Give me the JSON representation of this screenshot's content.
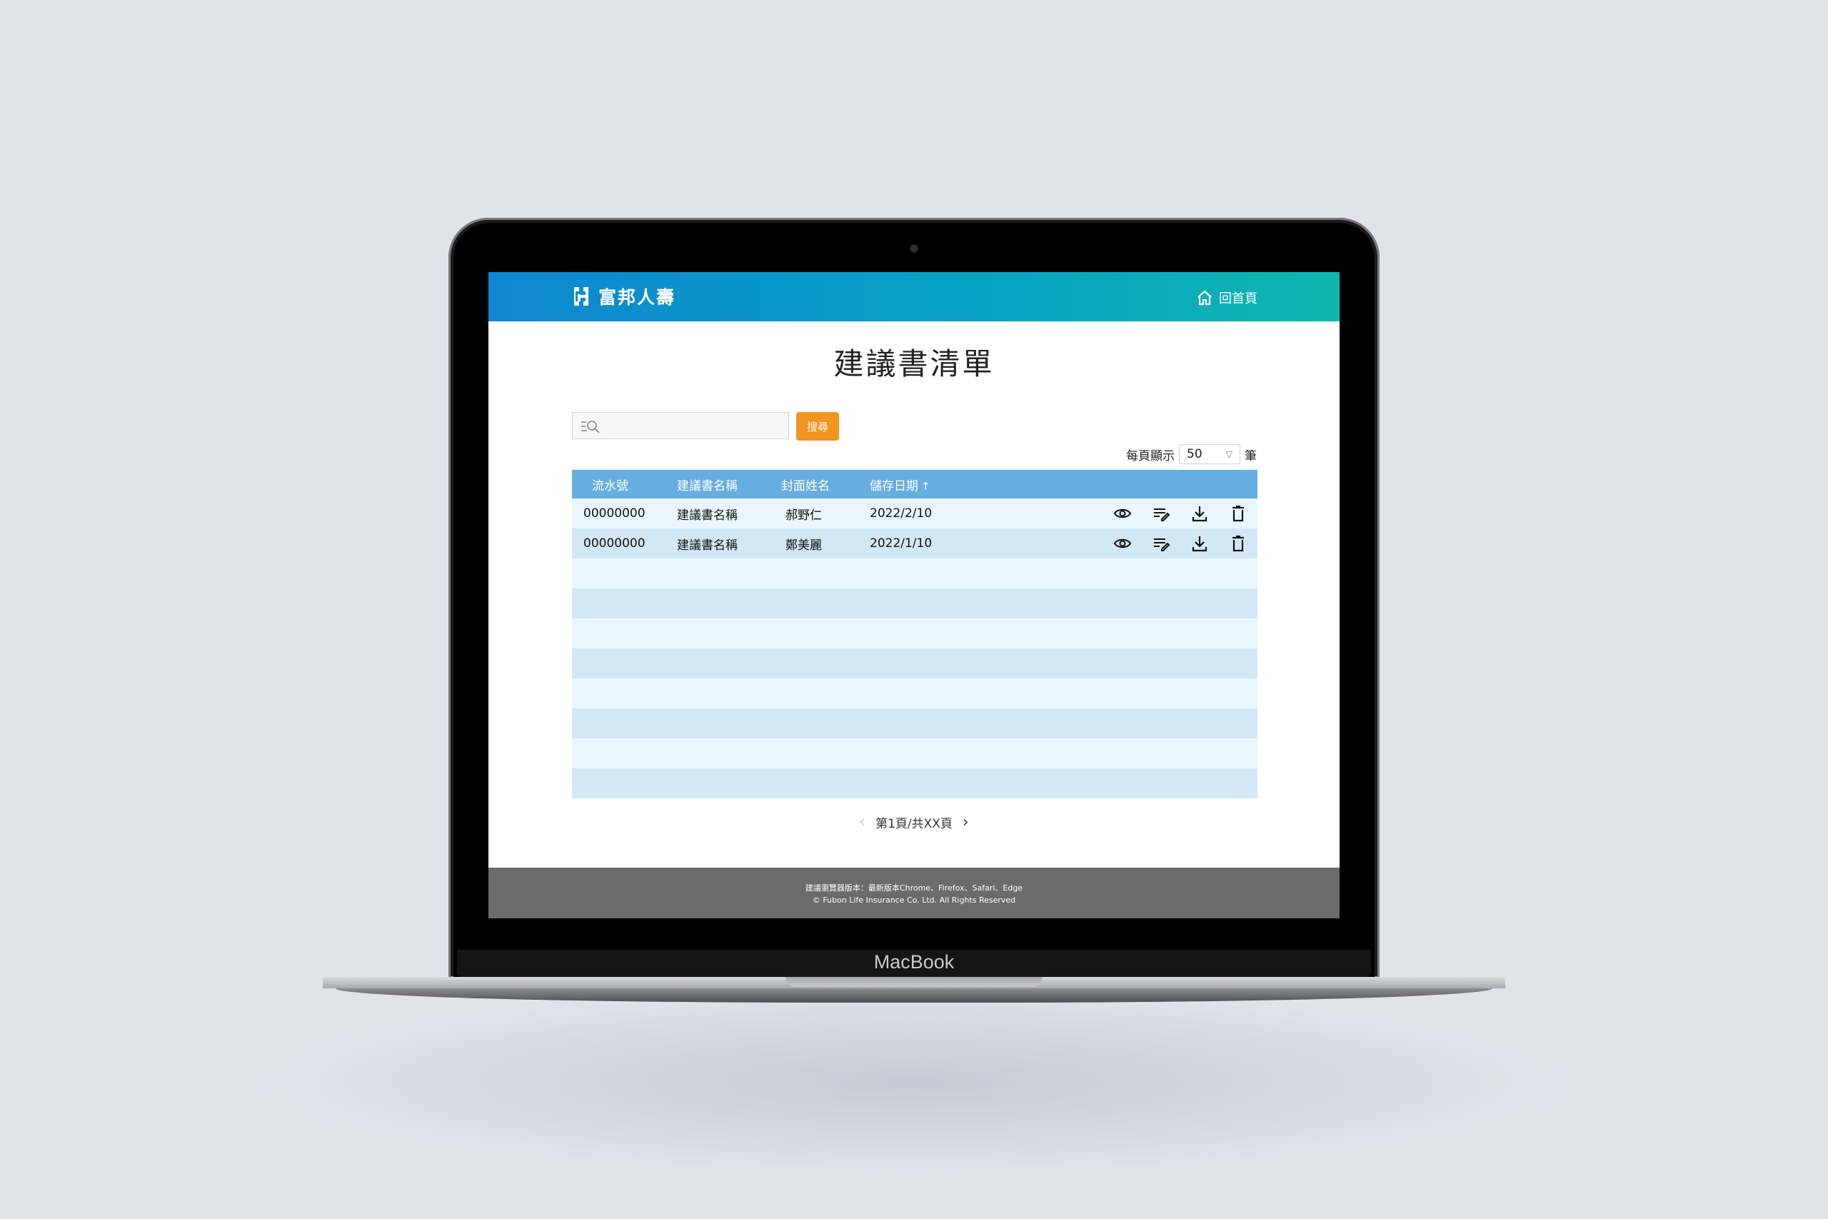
{
  "device": {
    "label": "MacBook"
  },
  "header": {
    "brand": "富邦人壽",
    "home_label": "回首頁"
  },
  "main": {
    "title": "建議書清單",
    "search": {
      "placeholder": "",
      "button_label": "搜尋"
    },
    "per_page": {
      "prefix": "每頁顯示",
      "value": "50",
      "suffix": "筆"
    }
  },
  "table": {
    "headers": [
      "流水號",
      "建議書名稱",
      "封面姓名",
      "儲存日期"
    ],
    "sort_indicator": "↑",
    "rows": [
      {
        "id": "00000000",
        "name": "建議書名稱",
        "cover_name": "郝野仁",
        "date": "2022/2/10"
      },
      {
        "id": "00000000",
        "name": "建議書名稱",
        "cover_name": "鄭美麗",
        "date": "2022/1/10"
      }
    ],
    "row_actions": [
      "eye-icon",
      "edit-icon",
      "download-icon",
      "trash-icon"
    ]
  },
  "pagination": {
    "prev": "‹",
    "label": "第1頁/共XX頁",
    "next": "›"
  },
  "footer": {
    "line1": "建議瀏覽器版本：最新版本Chrome、Firefox、Safari、Edge",
    "line2": "© Fubon Life Insurance Co. Ltd. All Rights Reserved"
  }
}
